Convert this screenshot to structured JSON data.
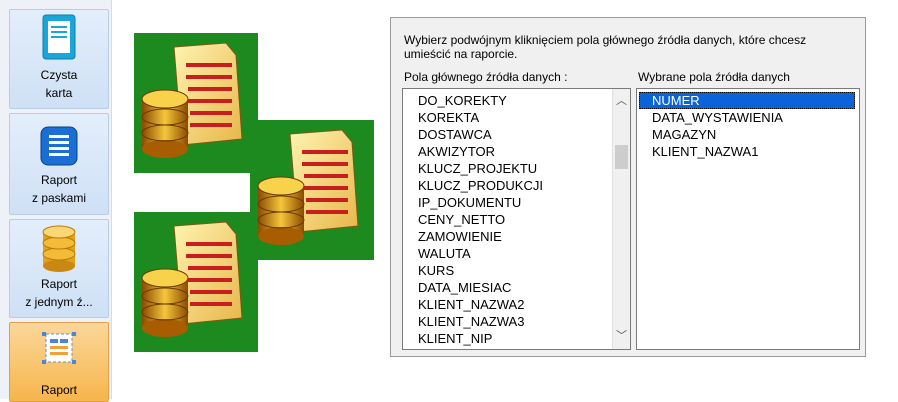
{
  "sidebar": {
    "buttons": [
      {
        "label_line1": "Czysta",
        "label_line2": "karta",
        "icon": "blank-page-icon"
      },
      {
        "label_line1": "Raport",
        "label_line2": "z paskami",
        "icon": "striped-report-icon"
      },
      {
        "label_line1": "Raport",
        "label_line2": "z jednym ź...",
        "icon": "database-icon"
      },
      {
        "label_line1": "Raport",
        "label_line2": "",
        "icon": "form-report-icon"
      }
    ],
    "active_index": 3
  },
  "panel": {
    "instruction": "Wybierz podwójnym kliknięciem pola głównego źródła danych, które chcesz umieścić na raporcie.",
    "source_caption": "Pola głównego źródła danych :",
    "selected_caption": "Wybrane pola źródła danych",
    "source_fields": [
      "DO_KOREKTY",
      "KOREKTA",
      "DOSTAWCA",
      "AKWIZYTOR",
      "KLUCZ_PROJEKTU",
      "KLUCZ_PRODUKCJI",
      "IP_DOKUMENTU",
      "CENY_NETTO",
      "ZAMOWIENIE",
      "WALUTA",
      "KURS",
      "DATA_MIESIAC",
      "KLIENT_NAZWA2",
      "KLIENT_NAZWA3",
      "KLIENT_NIP"
    ],
    "selected_fields": [
      "NUMER",
      "DATA_WYSTAWIENIA",
      "MAGAZYN",
      "KLIENT_NAZWA1"
    ],
    "selected_highlight": "NUMER"
  },
  "colors": {
    "selection": "#0a64d8",
    "active_tab": "#f7b54c",
    "tile_green": "#1a8a1a"
  }
}
